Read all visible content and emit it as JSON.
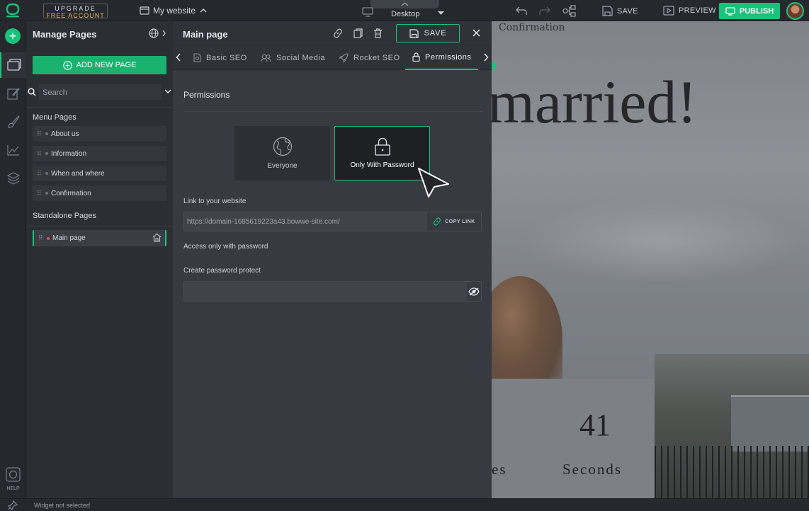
{
  "topbar": {
    "upgrade_line1": "UPGRADE",
    "upgrade_line2": "FREE ACCOUNT",
    "site_name": "My website",
    "device": "Desktop",
    "save_label": "SAVE",
    "preview_label": "PREVIEW",
    "publish_label": "PUBLISH"
  },
  "rail": {
    "help_label": "HELP"
  },
  "pages_panel": {
    "title": "Manage Pages",
    "add_button": "ADD NEW PAGE",
    "search_placeholder": "Search",
    "menu_section": "Menu Pages",
    "menu_pages": [
      "About us",
      "Information",
      "When and where",
      "Confirmation"
    ],
    "standalone_section": "Standalone Pages",
    "standalone_pages": [
      "Main page"
    ]
  },
  "settings": {
    "title": "Main page",
    "save_label": "SAVE",
    "tabs": [
      "Basic SEO",
      "Social Media",
      "Rocket SEO",
      "Permissions"
    ],
    "permissions_title": "Permissions",
    "options": [
      "Everyone",
      "Only With Password"
    ],
    "link_label": "Link to your website",
    "link_url": "https://domain-1685619223a43.bowwe-site.com/",
    "copy_link": "COPY LINK",
    "access_label": "Access only with password",
    "password_label": "Create password protect",
    "password_value": ""
  },
  "canvas": {
    "nav_item": "Confirmation",
    "headline": "married!",
    "counter_value": "41",
    "counter_label": "Seconds",
    "counter_partial": "es"
  },
  "status": {
    "text": "Widget not selected"
  },
  "colors": {
    "accent": "#19c27a",
    "panel": "#373a41",
    "sidebar": "#2b2e33",
    "topbar": "#25282d"
  }
}
